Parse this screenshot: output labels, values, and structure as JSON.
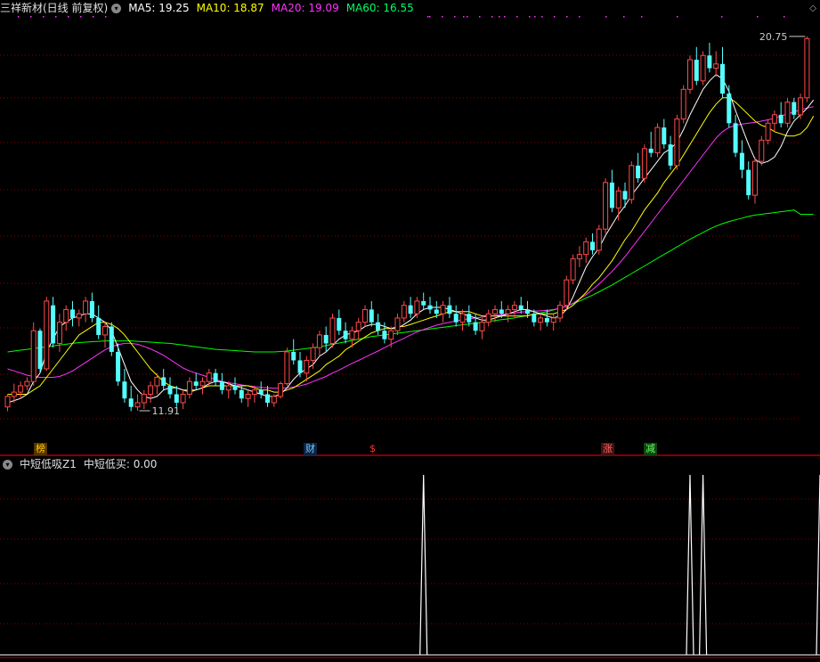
{
  "main_header": {
    "title": "三祥新材(日线 前复权)",
    "ma5": "MA5: 19.25",
    "ma10": "MA10: 18.87",
    "ma20": "MA20: 19.09",
    "ma60": "MA60: 16.55"
  },
  "indicator_header": {
    "title": "中短低吸Z1",
    "value": "中短低买: 0.00"
  },
  "event_tags": [
    {
      "label": "榜",
      "color": "#ffcc00",
      "bg": "#553300"
    },
    {
      "label": "财",
      "color": "#66ccff",
      "bg": "#112244"
    },
    {
      "label": "$",
      "color": "#ff3333",
      "bg": "transparent"
    },
    {
      "label": "涨",
      "color": "#ff6666",
      "bg": "#441111"
    },
    {
      "label": "减",
      "color": "#66ff66",
      "bg": "#114411"
    }
  ],
  "colors": {
    "up": "#ff4a4a",
    "down": "#54ffff",
    "ma5": "#ffffff",
    "ma10": "#ffff00",
    "ma20": "#ff33ff",
    "ma60": "#00ff00",
    "grid": "#8b0000",
    "divider": "#b00000",
    "signal": "#ffffff"
  },
  "chart_data": [
    {
      "type": "candlestick",
      "ylim": [
        11.3,
        21.4
      ],
      "annotations": [
        {
          "text": "20.75",
          "value": 20.75
        },
        {
          "text": "11.91",
          "value": 11.91
        }
      ],
      "series_names": [
        "MA5",
        "MA10",
        "MA20",
        "MA60"
      ],
      "candles": [
        [
          12.0,
          12.3,
          11.9,
          12.25
        ],
        [
          12.25,
          12.55,
          12.1,
          12.35
        ],
        [
          12.35,
          12.6,
          12.2,
          12.5
        ],
        [
          12.5,
          12.7,
          12.4,
          12.6
        ],
        [
          12.6,
          14.0,
          12.5,
          13.8
        ],
        [
          13.8,
          13.85,
          12.8,
          12.9
        ],
        [
          12.9,
          14.6,
          12.85,
          14.5
        ],
        [
          14.4,
          14.6,
          13.4,
          13.5
        ],
        [
          13.5,
          14.2,
          13.3,
          14.0
        ],
        [
          14.0,
          14.4,
          13.8,
          14.3
        ],
        [
          14.3,
          14.5,
          13.9,
          14.1
        ],
        [
          14.1,
          14.3,
          13.9,
          14.2
        ],
        [
          14.2,
          14.6,
          14.0,
          14.5
        ],
        [
          14.5,
          14.7,
          14.0,
          14.1
        ],
        [
          14.1,
          14.4,
          13.6,
          13.7
        ],
        [
          13.7,
          14.0,
          13.4,
          13.9
        ],
        [
          13.9,
          14.0,
          13.2,
          13.3
        ],
        [
          13.3,
          13.5,
          12.5,
          12.6
        ],
        [
          12.6,
          12.9,
          12.1,
          12.2
        ],
        [
          12.2,
          12.5,
          11.9,
          12.0
        ],
        [
          12.0,
          12.3,
          11.91,
          12.1
        ],
        [
          12.1,
          12.4,
          11.95,
          12.3
        ],
        [
          12.3,
          12.6,
          12.1,
          12.5
        ],
        [
          12.5,
          12.8,
          12.3,
          12.7
        ],
        [
          12.7,
          12.9,
          12.4,
          12.5
        ],
        [
          12.5,
          12.7,
          12.2,
          12.3
        ],
        [
          12.3,
          12.5,
          12.0,
          12.1
        ],
        [
          12.1,
          12.4,
          11.95,
          12.3
        ],
        [
          12.3,
          12.7,
          12.2,
          12.6
        ],
        [
          12.6,
          12.8,
          12.4,
          12.5
        ],
        [
          12.5,
          12.7,
          12.3,
          12.6
        ],
        [
          12.6,
          12.9,
          12.5,
          12.8
        ],
        [
          12.8,
          12.9,
          12.5,
          12.6
        ],
        [
          12.6,
          12.8,
          12.3,
          12.4
        ],
        [
          12.4,
          12.6,
          12.2,
          12.5
        ],
        [
          12.5,
          12.7,
          12.3,
          12.4
        ],
        [
          12.4,
          12.5,
          12.1,
          12.2
        ],
        [
          12.2,
          12.4,
          12.0,
          12.3
        ],
        [
          12.3,
          12.5,
          12.1,
          12.4
        ],
        [
          12.4,
          12.6,
          12.2,
          12.3
        ],
        [
          12.3,
          12.5,
          12.0,
          12.1
        ],
        [
          12.1,
          12.3,
          12.0,
          12.25
        ],
        [
          12.25,
          12.6,
          12.2,
          12.55
        ],
        [
          12.55,
          13.4,
          12.5,
          13.3
        ],
        [
          13.3,
          13.6,
          13.0,
          13.1
        ],
        [
          13.1,
          13.3,
          12.7,
          12.8
        ],
        [
          12.8,
          13.2,
          12.6,
          13.1
        ],
        [
          13.1,
          13.5,
          12.9,
          13.4
        ],
        [
          13.4,
          13.8,
          13.2,
          13.7
        ],
        [
          13.7,
          13.9,
          13.3,
          13.5
        ],
        [
          13.5,
          14.2,
          13.4,
          14.1
        ],
        [
          14.1,
          14.3,
          13.7,
          13.8
        ],
        [
          13.8,
          14.0,
          13.5,
          13.6
        ],
        [
          13.6,
          13.9,
          13.4,
          13.8
        ],
        [
          13.8,
          14.1,
          13.6,
          14.0
        ],
        [
          14.0,
          14.4,
          13.9,
          14.3
        ],
        [
          14.3,
          14.5,
          13.9,
          14.0
        ],
        [
          14.0,
          14.2,
          13.7,
          13.8
        ],
        [
          13.8,
          14.0,
          13.5,
          13.6
        ],
        [
          13.6,
          13.9,
          13.4,
          13.8
        ],
        [
          13.8,
          14.2,
          13.7,
          14.1
        ],
        [
          14.1,
          14.5,
          14.0,
          14.4
        ],
        [
          14.4,
          14.6,
          14.1,
          14.2
        ],
        [
          14.2,
          14.6,
          14.1,
          14.5
        ],
        [
          14.5,
          14.7,
          14.3,
          14.4
        ],
        [
          14.4,
          14.6,
          14.2,
          14.3
        ],
        [
          14.3,
          14.5,
          14.1,
          14.2
        ],
        [
          14.2,
          14.5,
          14.0,
          14.4
        ],
        [
          14.4,
          14.6,
          14.1,
          14.2
        ],
        [
          14.2,
          14.4,
          13.9,
          14.0
        ],
        [
          14.0,
          14.3,
          13.8,
          14.2
        ],
        [
          14.2,
          14.4,
          13.9,
          14.0
        ],
        [
          14.0,
          14.2,
          13.7,
          13.8
        ],
        [
          13.8,
          14.1,
          13.6,
          14.0
        ],
        [
          14.0,
          14.3,
          13.9,
          14.2
        ],
        [
          14.2,
          14.4,
          14.0,
          14.3
        ],
        [
          14.3,
          14.5,
          14.1,
          14.2
        ],
        [
          14.2,
          14.4,
          14.0,
          14.3
        ],
        [
          14.3,
          14.5,
          14.1,
          14.4
        ],
        [
          14.4,
          14.6,
          14.2,
          14.3
        ],
        [
          14.3,
          14.5,
          14.1,
          14.2
        ],
        [
          14.2,
          14.3,
          13.9,
          14.0
        ],
        [
          14.0,
          14.2,
          13.8,
          14.1
        ],
        [
          14.1,
          14.3,
          13.9,
          14.0
        ],
        [
          14.0,
          14.2,
          13.8,
          14.1
        ],
        [
          14.1,
          14.5,
          14.0,
          14.4
        ],
        [
          14.4,
          15.1,
          14.3,
          15.0
        ],
        [
          15.0,
          15.6,
          14.9,
          15.5
        ],
        [
          15.5,
          15.8,
          15.3,
          15.6
        ],
        [
          15.6,
          16.0,
          15.4,
          15.9
        ],
        [
          15.9,
          16.1,
          15.6,
          15.7
        ],
        [
          15.7,
          16.3,
          15.6,
          16.2
        ],
        [
          16.2,
          17.4,
          16.1,
          17.3
        ],
        [
          17.3,
          17.6,
          16.6,
          16.7
        ],
        [
          16.7,
          17.2,
          16.4,
          17.1
        ],
        [
          17.1,
          17.3,
          16.7,
          16.9
        ],
        [
          16.9,
          17.8,
          16.8,
          17.7
        ],
        [
          17.7,
          18.0,
          17.3,
          17.4
        ],
        [
          17.4,
          18.2,
          17.3,
          18.1
        ],
        [
          18.1,
          18.5,
          17.9,
          18.0
        ],
        [
          18.0,
          18.7,
          17.9,
          18.6
        ],
        [
          18.6,
          18.8,
          18.1,
          18.2
        ],
        [
          18.2,
          18.4,
          17.6,
          17.7
        ],
        [
          17.7,
          18.9,
          17.6,
          18.8
        ],
        [
          18.8,
          19.6,
          18.7,
          19.5
        ],
        [
          19.5,
          20.3,
          19.4,
          20.2
        ],
        [
          20.2,
          20.5,
          19.6,
          19.7
        ],
        [
          19.7,
          20.4,
          19.6,
          20.3
        ],
        [
          20.3,
          20.6,
          19.9,
          20.0
        ],
        [
          20.0,
          20.4,
          19.8,
          20.1
        ],
        [
          20.1,
          20.5,
          19.3,
          19.4
        ],
        [
          19.4,
          19.6,
          18.6,
          18.7
        ],
        [
          18.7,
          18.9,
          17.9,
          18.0
        ],
        [
          18.0,
          18.3,
          17.4,
          17.6
        ],
        [
          17.6,
          17.8,
          16.9,
          17.0
        ],
        [
          17.0,
          17.9,
          16.8,
          17.8
        ],
        [
          17.8,
          18.4,
          17.7,
          18.3
        ],
        [
          18.3,
          18.8,
          18.2,
          18.7
        ],
        [
          18.7,
          19.0,
          18.5,
          18.9
        ],
        [
          18.9,
          19.2,
          18.6,
          18.7
        ],
        [
          18.7,
          19.3,
          18.6,
          19.2
        ],
        [
          19.2,
          19.3,
          18.8,
          18.9
        ],
        [
          18.9,
          19.4,
          18.8,
          19.3
        ],
        [
          19.3,
          20.75,
          19.2,
          20.7
        ]
      ],
      "ma5": [
        12.1,
        12.15,
        12.2,
        12.3,
        12.6,
        12.8,
        13.3,
        13.6,
        13.9,
        14.0,
        14.1,
        14.15,
        14.2,
        14.2,
        14.1,
        14.0,
        13.8,
        13.4,
        13.0,
        12.6,
        12.4,
        12.25,
        12.2,
        12.25,
        12.4,
        12.45,
        12.45,
        12.4,
        12.35,
        12.4,
        12.45,
        12.55,
        12.6,
        12.6,
        12.55,
        12.5,
        12.45,
        12.4,
        12.35,
        12.3,
        12.25,
        12.25,
        12.3,
        12.45,
        12.65,
        12.8,
        12.9,
        13.0,
        13.2,
        13.3,
        13.45,
        13.6,
        13.7,
        13.75,
        13.8,
        13.9,
        13.95,
        13.95,
        13.9,
        13.85,
        13.85,
        13.95,
        14.05,
        14.2,
        14.3,
        14.35,
        14.35,
        14.35,
        14.3,
        14.25,
        14.2,
        14.15,
        14.1,
        14.05,
        14.05,
        14.1,
        14.15,
        14.2,
        14.25,
        14.3,
        14.3,
        14.25,
        14.2,
        14.15,
        14.1,
        14.15,
        14.3,
        14.6,
        14.95,
        15.3,
        15.55,
        15.75,
        16.05,
        16.3,
        16.55,
        16.75,
        17.0,
        17.2,
        17.4,
        17.6,
        17.8,
        18.0,
        18.1,
        18.25,
        18.55,
        18.9,
        19.2,
        19.5,
        19.7,
        19.85,
        19.75,
        19.45,
        19.0,
        18.6,
        18.2,
        17.85,
        17.75,
        17.8,
        17.9,
        18.15,
        18.5,
        18.75,
        18.9,
        19.05,
        19.25
      ],
      "ma10": [
        12.3,
        12.3,
        12.3,
        12.3,
        12.4,
        12.5,
        12.7,
        12.9,
        13.1,
        13.3,
        13.5,
        13.7,
        13.8,
        13.9,
        14.0,
        14.0,
        13.95,
        13.85,
        13.7,
        13.5,
        13.3,
        13.1,
        12.9,
        12.75,
        12.6,
        12.5,
        12.45,
        12.4,
        12.4,
        12.4,
        12.45,
        12.5,
        12.5,
        12.5,
        12.5,
        12.5,
        12.5,
        12.5,
        12.45,
        12.4,
        12.4,
        12.35,
        12.35,
        12.4,
        12.45,
        12.55,
        12.65,
        12.75,
        12.85,
        13.0,
        13.1,
        13.2,
        13.35,
        13.45,
        13.55,
        13.65,
        13.75,
        13.8,
        13.85,
        13.85,
        13.9,
        13.9,
        13.95,
        14.0,
        14.05,
        14.1,
        14.15,
        14.2,
        14.25,
        14.25,
        14.25,
        14.25,
        14.2,
        14.15,
        14.15,
        14.15,
        14.15,
        14.15,
        14.15,
        14.15,
        14.15,
        14.2,
        14.2,
        14.2,
        14.2,
        14.25,
        14.3,
        14.4,
        14.55,
        14.7,
        14.9,
        15.05,
        15.25,
        15.45,
        15.7,
        15.95,
        16.15,
        16.4,
        16.65,
        16.85,
        17.05,
        17.3,
        17.5,
        17.7,
        17.95,
        18.2,
        18.45,
        18.7,
        18.95,
        19.15,
        19.3,
        19.3,
        19.2,
        19.05,
        18.9,
        18.75,
        18.65,
        18.6,
        18.5,
        18.45,
        18.4,
        18.4,
        18.45,
        18.6,
        18.87
      ],
      "ma20": [
        12.9,
        12.85,
        12.8,
        12.75,
        12.72,
        12.7,
        12.7,
        12.7,
        12.72,
        12.78,
        12.85,
        12.95,
        13.05,
        13.15,
        13.25,
        13.35,
        13.42,
        13.47,
        13.5,
        13.5,
        13.48,
        13.43,
        13.37,
        13.3,
        13.22,
        13.12,
        13.02,
        12.92,
        12.85,
        12.8,
        12.75,
        12.7,
        12.65,
        12.6,
        12.57,
        12.55,
        12.52,
        12.5,
        12.48,
        12.46,
        12.45,
        12.44,
        12.44,
        12.45,
        12.47,
        12.5,
        12.54,
        12.6,
        12.66,
        12.72,
        12.8,
        12.87,
        12.95,
        13.03,
        13.1,
        13.17,
        13.25,
        13.32,
        13.4,
        13.48,
        13.55,
        13.62,
        13.7,
        13.77,
        13.83,
        13.88,
        13.93,
        13.97,
        14.0,
        14.03,
        14.06,
        14.08,
        14.1,
        14.12,
        14.14,
        14.16,
        14.18,
        14.2,
        14.22,
        14.24,
        14.25,
        14.26,
        14.27,
        14.28,
        14.3,
        14.33,
        14.38,
        14.45,
        14.55,
        14.65,
        14.77,
        14.9,
        15.05,
        15.2,
        15.37,
        15.55,
        15.75,
        15.95,
        16.15,
        16.35,
        16.55,
        16.75,
        16.95,
        17.15,
        17.35,
        17.55,
        17.75,
        17.95,
        18.15,
        18.35,
        18.5,
        18.6,
        18.65,
        18.68,
        18.7,
        18.72,
        18.75,
        18.78,
        18.82,
        18.87,
        18.92,
        18.97,
        19.02,
        19.06,
        19.09
      ],
      "ma60": [
        13.3,
        13.32,
        13.34,
        13.36,
        13.38,
        13.4,
        13.42,
        13.44,
        13.46,
        13.48,
        13.5,
        13.52,
        13.53,
        13.54,
        13.55,
        13.56,
        13.56,
        13.56,
        13.56,
        13.56,
        13.55,
        13.54,
        13.53,
        13.52,
        13.51,
        13.5,
        13.48,
        13.46,
        13.44,
        13.42,
        13.4,
        13.38,
        13.36,
        13.35,
        13.34,
        13.33,
        13.32,
        13.31,
        13.3,
        13.3,
        13.3,
        13.3,
        13.31,
        13.32,
        13.34,
        13.36,
        13.38,
        13.4,
        13.42,
        13.45,
        13.48,
        13.51,
        13.54,
        13.57,
        13.6,
        13.63,
        13.66,
        13.68,
        13.7,
        13.72,
        13.74,
        13.76,
        13.78,
        13.8,
        13.82,
        13.84,
        13.86,
        13.88,
        13.9,
        13.92,
        13.94,
        13.96,
        13.98,
        14.0,
        14.02,
        14.04,
        14.06,
        14.08,
        14.1,
        14.13,
        14.16,
        14.19,
        14.22,
        14.25,
        14.29,
        14.33,
        14.38,
        14.44,
        14.5,
        14.57,
        14.64,
        14.72,
        14.8,
        14.88,
        14.97,
        15.06,
        15.15,
        15.24,
        15.33,
        15.42,
        15.51,
        15.6,
        15.69,
        15.78,
        15.87,
        15.96,
        16.04,
        16.12,
        16.2,
        16.27,
        16.33,
        16.38,
        16.42,
        16.46,
        16.5,
        16.53,
        16.55,
        16.57,
        16.59,
        16.61,
        16.63,
        16.65,
        16.55,
        16.55,
        16.55
      ]
    },
    {
      "type": "line",
      "ylim": [
        0,
        1
      ],
      "series_names": [
        "中短低买"
      ],
      "signal_bars": [
        64,
        105,
        107,
        125,
        127
      ]
    }
  ]
}
